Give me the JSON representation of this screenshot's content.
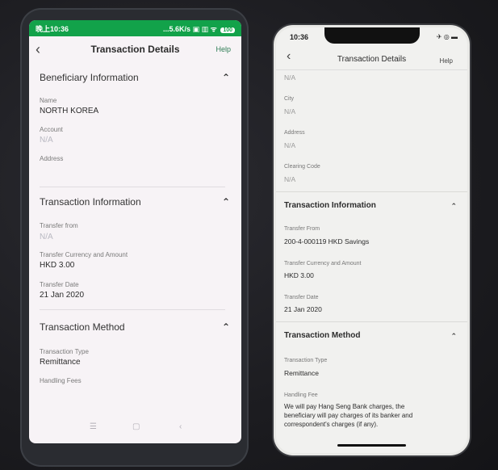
{
  "left_phone": {
    "status_time": "晚上10:36",
    "status_right": "...5.6K/s ▣ ▥ ᯤ",
    "battery": "100",
    "title": "Transaction Details",
    "help": "Help",
    "sections": {
      "beneficiary": "Beneficiary Information",
      "transaction": "Transaction Information",
      "method": "Transaction Method"
    },
    "fields": {
      "name_label": "Name",
      "name_value": "NORTH KOREA",
      "account_label": "Account",
      "account_value": "N/A",
      "address_label": "Address",
      "transfer_from_label": "Transfer from",
      "transfer_from_value": "N/A",
      "currency_label": "Transfer Currency and Amount",
      "currency_value": "HKD 3.00",
      "date_label": "Transfer Date",
      "date_value": "21 Jan 2020",
      "type_label": "Transaction Type",
      "type_value": "Remittance",
      "fees_label": "Handling Fees"
    },
    "softkeys": {
      "menu": "☰",
      "home": "▢",
      "back": "‹"
    }
  },
  "right_phone": {
    "status_time": "10:36",
    "status_icons": "✈ ◎ ▬",
    "title": "Transaction Details",
    "help": "Help",
    "fields": {
      "top_value": "N/A",
      "city_label": "City",
      "city_value": "N/A",
      "address_label": "Address",
      "address_value": "N/A",
      "clearing_label": "Clearing Code",
      "clearing_value": "N/A",
      "transfer_from_label": "Transfer From",
      "transfer_from_value": "200-4-000119 HKD Savings",
      "currency_label": "Transfer Currency and Amount",
      "currency_value": "HKD 3.00",
      "date_label": "Transfer Date",
      "date_value": "21 Jan 2020",
      "type_label": "Transaction Type",
      "type_value": "Remittance",
      "fees_label": "Handling Fee",
      "fees_line1": "We will pay Hang Seng Bank charges, the",
      "fees_line2": "beneficiary will pay charges of its banker and",
      "fees_line3": "correspondent's charges (if any)."
    },
    "sections": {
      "transaction": "Transaction Information",
      "method": "Transaction Method"
    }
  },
  "colors": {
    "android_status_bar": "#12a24a",
    "help_link": "#2e7d55",
    "na_text": "#b9b9c2"
  },
  "icons": {
    "back": "chevron-left-icon",
    "collapse": "chevron-up-icon"
  }
}
